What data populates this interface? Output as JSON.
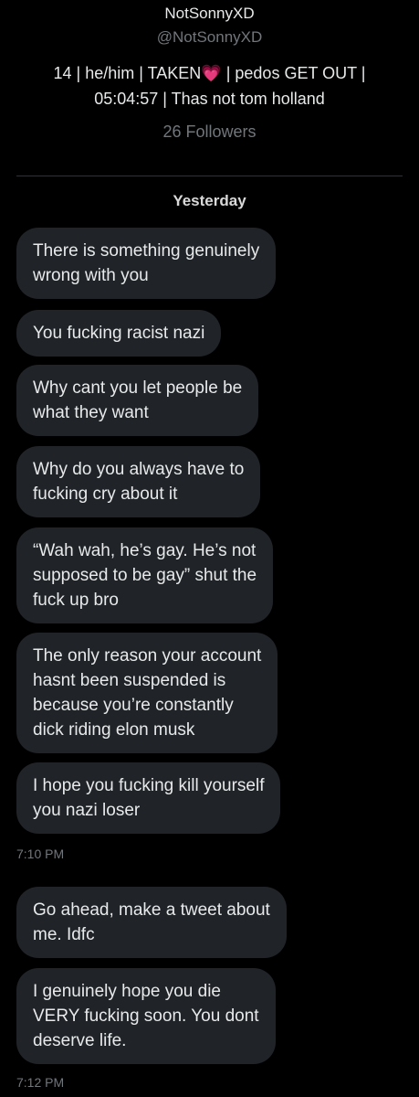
{
  "profile": {
    "display_name": "NotSonnyXD",
    "handle": "@NotSonnyXD",
    "bio_line1_prefix": "14 | he/him | TAKEN",
    "bio_heart": "💗",
    "bio_line1_suffix": " | pedos GET OUT |",
    "bio_line2": "05:04:57 | Thas not tom holland",
    "followers": "26 Followers"
  },
  "conversation": {
    "day_label": "Yesterday",
    "messages": [
      {
        "text": "There is something genuinely\nwrong with you"
      },
      {
        "text": "You fucking racist nazi"
      },
      {
        "text": "Why cant you let people be\nwhat they want"
      },
      {
        "text": "Why do you always have to\nfucking cry about it"
      },
      {
        "text": "“Wah wah, he’s gay. He’s not\nsupposed to be gay” shut the\nfuck up bro"
      },
      {
        "text": "The only reason your account\nhasnt been suspended is\nbecause you’re constantly\ndick riding elon musk"
      },
      {
        "text": "I hope you fucking kill yourself\nyou nazi loser"
      },
      {
        "text": "Go ahead, make a tweet about\nme. Idfc"
      },
      {
        "text": "I genuinely hope you die\nVERY fucking soon. You dont\ndeserve life."
      }
    ],
    "timestamps": [
      "7:10 PM",
      "7:12 PM"
    ]
  },
  "colors": {
    "background": "#000000",
    "bubble": "#202327",
    "text_primary": "#e7e9ea",
    "text_secondary": "#71767b",
    "heart": "#f4578a"
  }
}
